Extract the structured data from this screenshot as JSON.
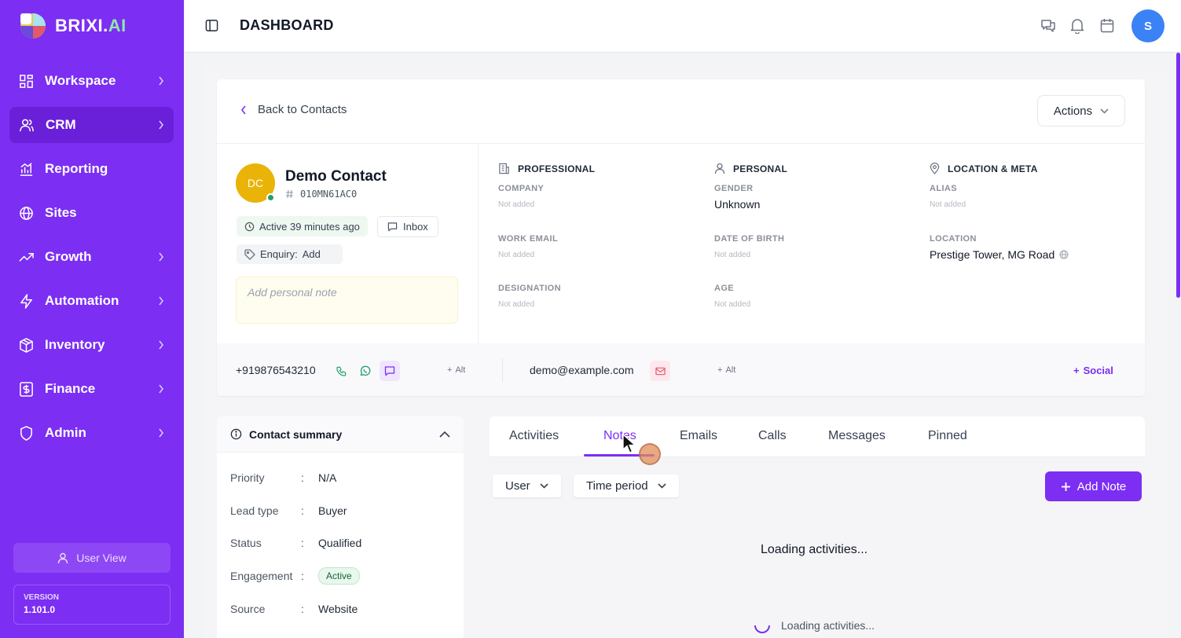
{
  "brand": {
    "name": "BRIXI.",
    "suffix": "AI"
  },
  "sidebar": {
    "items": [
      {
        "label": "Workspace",
        "icon": "grid-icon",
        "chevron": true
      },
      {
        "label": "CRM",
        "icon": "users-icon",
        "chevron": true,
        "active": true
      },
      {
        "label": "Reporting",
        "icon": "bar-chart-icon",
        "chevron": false
      },
      {
        "label": "Sites",
        "icon": "globe-icon",
        "chevron": false
      },
      {
        "label": "Growth",
        "icon": "trending-up-icon",
        "chevron": true
      },
      {
        "label": "Automation",
        "icon": "zap-icon",
        "chevron": true
      },
      {
        "label": "Inventory",
        "icon": "box-icon",
        "chevron": true
      },
      {
        "label": "Finance",
        "icon": "dollar-icon",
        "chevron": true
      },
      {
        "label": "Admin",
        "icon": "shield-icon",
        "chevron": true
      }
    ],
    "user_view": "User View",
    "version_label": "VERSION",
    "version_value": "1.101.0"
  },
  "header": {
    "title": "DASHBOARD",
    "avatar_initial": "S"
  },
  "contact": {
    "back_label": "Back to Contacts",
    "actions_label": "Actions",
    "initials": "DC",
    "name": "Demo Contact",
    "id": "010MN61AC0",
    "active_status": "Active 39 minutes ago",
    "inbox_label": "Inbox",
    "enquiry_label": "Enquiry:",
    "enquiry_value": "Add",
    "note_placeholder": "Add personal note",
    "professional": {
      "heading": "PROFESSIONAL",
      "company_label": "COMPANY",
      "company_value": "Not added",
      "work_email_label": "WORK EMAIL",
      "work_email_value": "Not added",
      "designation_label": "DESIGNATION",
      "designation_value": "Not added"
    },
    "personal": {
      "heading": "PERSONAL",
      "gender_label": "GENDER",
      "gender_value": "Unknown",
      "dob_label": "DATE OF BIRTH",
      "dob_value": "Not added",
      "age_label": "AGE",
      "age_value": "Not added"
    },
    "location_meta": {
      "heading": "LOCATION & META",
      "alias_label": "ALIAS",
      "alias_value": "Not added",
      "location_label": "LOCATION",
      "location_value": "Prestige Tower, MG Road"
    },
    "phone": "+919876543210",
    "alt_label": "Alt",
    "email": "demo@example.com",
    "social_label": "Social"
  },
  "summary": {
    "title": "Contact summary",
    "rows": [
      {
        "key": "Priority",
        "value": "N/A"
      },
      {
        "key": "Lead type",
        "value": "Buyer"
      },
      {
        "key": "Status",
        "value": "Qualified"
      },
      {
        "key": "Engagement",
        "value": "Active"
      },
      {
        "key": "Source",
        "value": "Website"
      }
    ]
  },
  "tabs": {
    "items": [
      "Activities",
      "Notes",
      "Emails",
      "Calls",
      "Messages",
      "Pinned"
    ],
    "active": "Notes"
  },
  "filters": {
    "user": "User",
    "time_period": "Time period"
  },
  "add_note_label": "Add Note",
  "loading": {
    "main": "Loading activities...",
    "sub": "Loading activities..."
  },
  "colors": {
    "accent": "#7c2ef3",
    "sidebar": "#7c2ef3",
    "avatar_dc": "#eab308",
    "avatar_s": "#3b82f6"
  }
}
